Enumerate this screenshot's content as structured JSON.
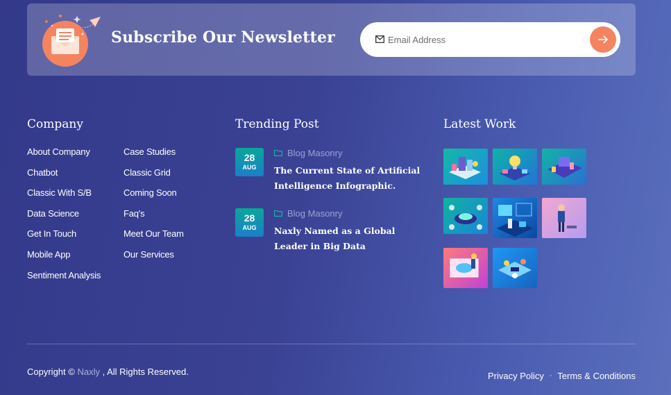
{
  "newsletter": {
    "title": "Subscribe Our Newsletter",
    "email_placeholder": "Email Address",
    "icon": "envelope-illustration",
    "submit_icon": "arrow-right-icon"
  },
  "company": {
    "heading": "Company",
    "col1": [
      "About Company",
      "Chatbot",
      "Classic With S/B",
      "Data Science",
      "Get In Touch",
      "Mobile App",
      "Sentiment Analysis"
    ],
    "col2": [
      "Case Studies",
      "Classic Grid",
      "Coming Soon",
      "Faq's",
      "Meet Our Team",
      "Our Services"
    ]
  },
  "trending": {
    "heading": "Trending Post",
    "posts": [
      {
        "day": "28",
        "month": "AUG",
        "category": "Blog Masonry",
        "title": "The Current State of Artificial Intelligence Infographic."
      },
      {
        "day": "28",
        "month": "AUG",
        "category": "Blog Masonry",
        "title": "Naxly Named as a Global Leader in Big Data"
      }
    ]
  },
  "latest_work": {
    "heading": "Latest Work",
    "thumbnails": [
      "isometric-city",
      "lightbulb-idea",
      "isometric-office",
      "isometric-network",
      "data-center",
      "businessman-presenting",
      "world-map-screen",
      "team-meeting"
    ]
  },
  "footer": {
    "copyright_prefix": "Copyright ©",
    "brand": "Naxly",
    "copyright_suffix": ", All Rights Reserved.",
    "privacy": "Privacy Policy",
    "separator": "-",
    "terms": "Terms & Conditions"
  },
  "colors": {
    "accent": "#f4845f",
    "date_badge_start": "#0aa79a",
    "date_badge_end": "#1b7fc8",
    "muted_text": "#9aa3d6"
  }
}
